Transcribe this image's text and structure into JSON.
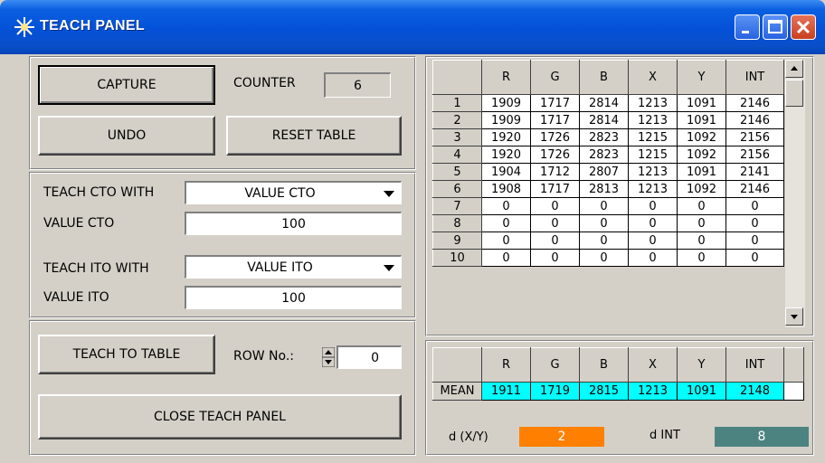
{
  "window": {
    "title": "TEACH PANEL",
    "icon": "star-burst-icon",
    "controls": [
      "minimize-icon",
      "maximize-icon",
      "close-icon"
    ]
  },
  "capture_panel": {
    "capture_label": "CAPTURE",
    "counter_label": "COUNTER",
    "counter_value": "6",
    "undo_label": "UNDO",
    "reset_label": "RESET TABLE"
  },
  "teach_panel": {
    "cto_with_label": "TEACH CTO WITH",
    "cto_with_value": "VALUE CTO",
    "value_cto_label": "VALUE CTO",
    "value_cto": "100",
    "ito_with_label": "TEACH ITO WITH",
    "ito_with_value": "VALUE ITO",
    "value_ito_label": "VALUE ITO",
    "value_ito": "100"
  },
  "bottom_panel": {
    "teach_to_table_label": "TEACH TO TABLE",
    "row_no_label": "ROW No.:",
    "row_no_value": "0",
    "close_label": "CLOSE TEACH PANEL"
  },
  "table": {
    "columns": [
      "R",
      "G",
      "B",
      "X",
      "Y",
      "INT"
    ],
    "rows": [
      {
        "n": "1",
        "v": [
          "1909",
          "1717",
          "2814",
          "1213",
          "1091",
          "2146"
        ]
      },
      {
        "n": "2",
        "v": [
          "1909",
          "1717",
          "2814",
          "1213",
          "1091",
          "2146"
        ]
      },
      {
        "n": "3",
        "v": [
          "1920",
          "1726",
          "2823",
          "1215",
          "1092",
          "2156"
        ]
      },
      {
        "n": "4",
        "v": [
          "1920",
          "1726",
          "2823",
          "1215",
          "1092",
          "2156"
        ]
      },
      {
        "n": "5",
        "v": [
          "1904",
          "1712",
          "2807",
          "1213",
          "1091",
          "2141"
        ]
      },
      {
        "n": "6",
        "v": [
          "1908",
          "1717",
          "2813",
          "1213",
          "1092",
          "2146"
        ]
      },
      {
        "n": "7",
        "v": [
          "0",
          "0",
          "0",
          "0",
          "0",
          "0"
        ]
      },
      {
        "n": "8",
        "v": [
          "0",
          "0",
          "0",
          "0",
          "0",
          "0"
        ]
      },
      {
        "n": "9",
        "v": [
          "0",
          "0",
          "0",
          "0",
          "0",
          "0"
        ]
      },
      {
        "n": "10",
        "v": [
          "0",
          "0",
          "0",
          "0",
          "0",
          "0"
        ]
      }
    ]
  },
  "mean_table": {
    "columns": [
      "R",
      "G",
      "B",
      "X",
      "Y",
      "INT"
    ],
    "row_label": "MEAN",
    "values": [
      "1911",
      "1719",
      "2815",
      "1213",
      "1091",
      "2148"
    ],
    "highlight_color": "#00ffff"
  },
  "deltas": {
    "dxy_label": "d (X/Y)",
    "dxy_value": "2",
    "dxy_color": "#ff8000",
    "dint_label": "d INT",
    "dint_value": "8",
    "dint_color": "#4c8380"
  }
}
